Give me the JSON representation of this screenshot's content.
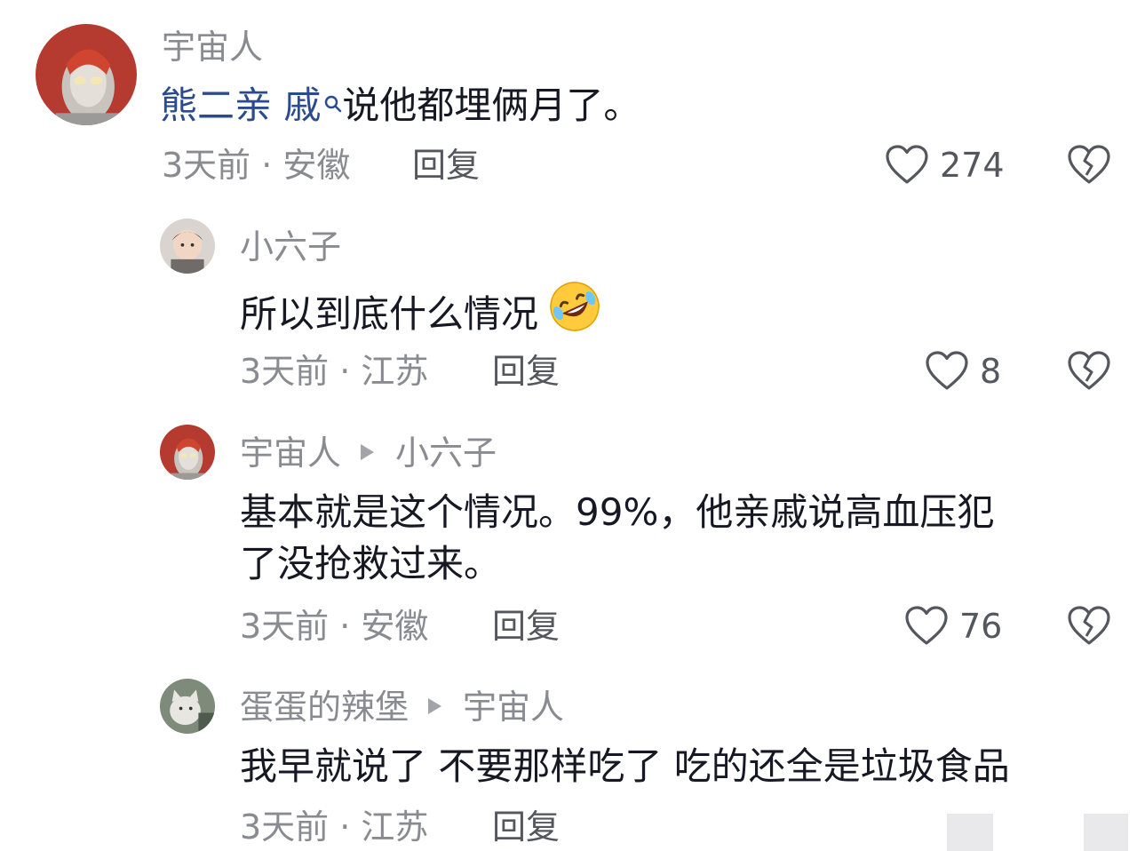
{
  "comments": [
    {
      "username": "宇宙人",
      "reply_to": "",
      "link_text": "熊二亲 戚",
      "text": "说他都埋俩月了。",
      "time_location": "3天前 · 安徽",
      "reply_label": "回复",
      "likes": "274",
      "avatar_icon": "ultraman-avatar"
    },
    {
      "username": "小六子",
      "reply_to": "",
      "text": "所以到底什么情况",
      "emoji": "rolling-laughing-emoji",
      "time_location": "3天前 · 江苏",
      "reply_label": "回复",
      "likes": "8",
      "avatar_icon": "child-avatar"
    },
    {
      "username": "宇宙人",
      "reply_to": "小六子",
      "text_line1": "基本就是这个情况。99%，他亲戚说高血压犯",
      "text_line2": "了没抢救过来。",
      "time_location": "3天前 · 安徽",
      "reply_label": "回复",
      "likes": "76",
      "avatar_icon": "ultraman-avatar"
    },
    {
      "username": "蛋蛋的辣堡",
      "reply_to": "宇宙人",
      "text": "我早就说了 不要那样吃了 吃的还全是垃圾食品",
      "time_location": "3天前 · 江苏",
      "reply_label": "回复",
      "avatar_icon": "cat-avatar"
    }
  ],
  "colors": {
    "link": "#2a4b8d",
    "meta": "#8a8b91",
    "text": "#161823"
  }
}
